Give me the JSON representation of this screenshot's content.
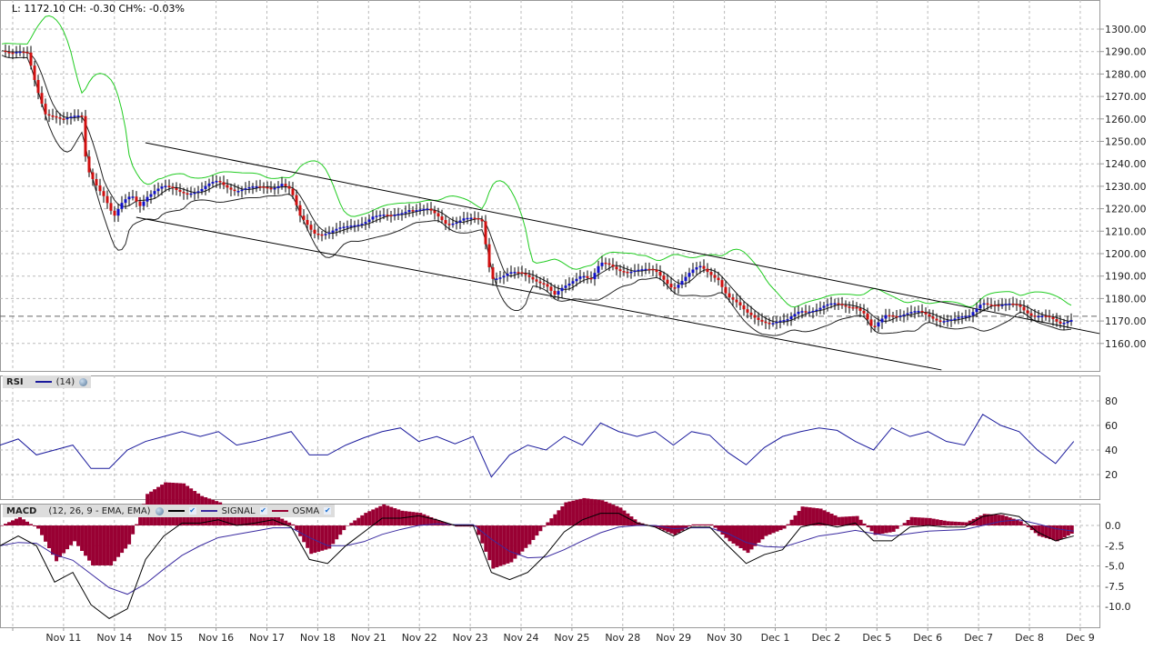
{
  "info": {
    "last": "L: 1172.10",
    "change": "CH: -0.30",
    "change_pct": "CH%: -0.03%"
  },
  "rsi_legend": {
    "name": "RSI",
    "params": "(14)"
  },
  "macd_legend": {
    "name": "MACD",
    "params": "(12, 26, 9 - EMA, EMA)",
    "signal": "SIGNAL",
    "osma": "OSMA"
  },
  "colors": {
    "up": "#1010c8",
    "down": "#d01010",
    "band": "#22cc22",
    "rsi": "#1a1a9c",
    "signal": "#3a2aa0",
    "osma": "#990033"
  },
  "chart_data": [
    {
      "type": "candlestick",
      "title": "Price",
      "current_price": 1172.1,
      "y_ticks": [
        "1300.00",
        "1290.00",
        "1280.00",
        "1270.00",
        "1260.00",
        "1250.00",
        "1240.00",
        "1230.00",
        "1220.00",
        "1210.00",
        "1200.00",
        "1190.00",
        "1180.00",
        "1170.00",
        "1160.00"
      ],
      "ylim": [
        1148,
        1313
      ],
      "x_labels": [
        "Nov 11",
        "Nov 14",
        "Nov 15",
        "Nov 16",
        "Nov 17",
        "Nov 18",
        "Nov 21",
        "Nov 22",
        "Nov 23",
        "Nov 24",
        "Nov 25",
        "Nov 28",
        "Nov 29",
        "Nov 30",
        "Dec 1",
        "Dec 2",
        "Dec 5",
        "Dec 6",
        "Dec 7",
        "Dec 8",
        "Dec 9"
      ],
      "close_points_day_index": [
        [
          -0.25,
          1290.7
        ],
        [
          0.11,
          1290.7
        ],
        [
          0.29,
          1288.7
        ],
        [
          0.47,
          1272.5
        ],
        [
          0.64,
          1262.3
        ],
        [
          0.82,
          1262.3
        ],
        [
          1.0,
          1260.3
        ],
        [
          1.18,
          1260.3
        ],
        [
          1.36,
          1260.3
        ],
        [
          1.45,
          1238.1
        ],
        [
          1.63,
          1232.0
        ],
        [
          1.81,
          1225.9
        ],
        [
          1.99,
          1215.8
        ],
        [
          2.16,
          1221.9
        ],
        [
          2.34,
          1225.9
        ],
        [
          2.52,
          1221.9
        ],
        [
          2.61,
          1225.9
        ],
        [
          2.79,
          1227.9
        ],
        [
          2.97,
          1229.1
        ],
        [
          3.33,
          1227.9
        ],
        [
          3.69,
          1227.9
        ],
        [
          3.86,
          1230.0
        ],
        [
          4.04,
          1232.0
        ],
        [
          4.4,
          1228.7
        ],
        [
          4.76,
          1228.7
        ],
        [
          5.12,
          1230.0
        ],
        [
          5.3,
          1232.0
        ],
        [
          5.47,
          1227.9
        ],
        [
          5.65,
          1215.8
        ],
        [
          5.92,
          1209.7
        ],
        [
          6.19,
          1209.7
        ],
        [
          6.55,
          1210.9
        ],
        [
          6.82,
          1213.8
        ],
        [
          7.08,
          1217.0
        ],
        [
          7.44,
          1215.8
        ],
        [
          7.8,
          1220.6
        ],
        [
          8.16,
          1219.0
        ],
        [
          8.52,
          1213.8
        ],
        [
          8.87,
          1215.8
        ],
        [
          9.23,
          1213.8
        ],
        [
          9.41,
          1189.5
        ],
        [
          9.77,
          1191.5
        ],
        [
          10.13,
          1189.5
        ],
        [
          10.48,
          1187.4
        ],
        [
          10.66,
          1181.4
        ],
        [
          10.93,
          1185.4
        ],
        [
          11.2,
          1191.5
        ],
        [
          11.38,
          1189.5
        ],
        [
          11.56,
          1195.5
        ],
        [
          11.91,
          1192.3
        ],
        [
          12.27,
          1193.5
        ],
        [
          12.63,
          1191.5
        ],
        [
          12.99,
          1185.4
        ],
        [
          13.35,
          1191.5
        ],
        [
          13.52,
          1193.5
        ],
        [
          13.88,
          1189.5
        ],
        [
          14.06,
          1181.4
        ],
        [
          14.42,
          1173.3
        ],
        [
          14.69,
          1171.3
        ],
        [
          14.96,
          1169.2
        ],
        [
          15.22,
          1169.2
        ],
        [
          15.49,
          1175.3
        ],
        [
          15.85,
          1175.3
        ],
        [
          16.21,
          1177.3
        ],
        [
          16.57,
          1177.3
        ],
        [
          16.74,
          1173.3
        ],
        [
          16.92,
          1165.2
        ],
        [
          17.19,
          1173.3
        ],
        [
          17.46,
          1173.3
        ],
        [
          17.82,
          1173.3
        ],
        [
          18.18,
          1171.3
        ],
        [
          18.53,
          1170.4
        ],
        [
          18.8,
          1171.3
        ],
        [
          19.07,
          1179.4
        ],
        [
          19.43,
          1176.1
        ],
        [
          19.79,
          1177.3
        ],
        [
          20.05,
          1173.3
        ],
        [
          20.32,
          1171.3
        ],
        [
          20.59,
          1168.4
        ],
        [
          20.86,
          1172.1
        ]
      ],
      "trendlines": [
        {
          "name": "upper",
          "from": [
            2.61,
            1249.4
          ],
          "to": [
            21.38,
            1164.4
          ]
        },
        {
          "name": "lower",
          "from": [
            2.43,
            1216.2
          ],
          "to": [
            18.27,
            1148.2
          ]
        }
      ]
    },
    {
      "type": "line",
      "title": "RSI (14)",
      "y_ticks": [
        "80",
        "60",
        "40",
        "20"
      ],
      "ylim": [
        0,
        100
      ],
      "sample_step_days": 0.358,
      "start_day_index": -0.25,
      "values": [
        44,
        49,
        36,
        40,
        44,
        25,
        25,
        40,
        47,
        51,
        55,
        51,
        55,
        44,
        47,
        51,
        55,
        36,
        36,
        44,
        50,
        55,
        58,
        47,
        51,
        45,
        51,
        18,
        36,
        44,
        40,
        51,
        44,
        62,
        55,
        51,
        55,
        44,
        55,
        52,
        38,
        28,
        42,
        51,
        55,
        58,
        56,
        47,
        40,
        58,
        51,
        55,
        47,
        44,
        69,
        60,
        55,
        40,
        29,
        47
      ]
    },
    {
      "type": "line",
      "title": "MACD (12, 26, 9 - EMA, EMA)",
      "y_ticks": [
        "0.0",
        "-2.5",
        "-5.0",
        "-7.5",
        "-10.0"
      ],
      "ylim": [
        -12.5,
        2.5
      ],
      "sample_step_days": 0.358,
      "start_day_index": -0.25,
      "series": [
        {
          "name": "MACD",
          "values": [
            -2.5,
            -1.3,
            -2.5,
            -7.0,
            -5.8,
            -9.8,
            -11.5,
            -10.3,
            -4.2,
            -1.3,
            0.3,
            0.3,
            0.7,
            0,
            0.3,
            0.7,
            -0.2,
            -4.2,
            -4.7,
            -2.5,
            -0.8,
            0.9,
            0.9,
            1.2,
            0.7,
            0,
            0,
            -5.8,
            -6.7,
            -5.8,
            -3.6,
            -0.8,
            0.7,
            1.5,
            1.5,
            0.3,
            -0.2,
            -1.3,
            -0.2,
            -0.2,
            -2.5,
            -4.7,
            -3.6,
            -3.0,
            -0.2,
            0.3,
            -0.2,
            0.3,
            -1.9,
            -1.9,
            -0.2,
            0,
            -0.2,
            -0.2,
            1.1,
            1.5,
            1.1,
            -0.8,
            -1.9,
            -1.3
          ]
        },
        {
          "name": "SIGNAL",
          "values": [
            -2.5,
            -2.1,
            -2.2,
            -3.6,
            -4.3,
            -6.0,
            -7.7,
            -8.5,
            -7.2,
            -5.4,
            -3.7,
            -2.5,
            -1.5,
            -1.1,
            -0.7,
            -0.3,
            -0.3,
            -1.5,
            -2.5,
            -2.5,
            -2.0,
            -1.1,
            -0.5,
            0.0,
            0.2,
            0.1,
            0.1,
            -1.7,
            -3.2,
            -4.0,
            -3.9,
            -3.0,
            -1.9,
            -0.9,
            -0.2,
            0.0,
            0.0,
            -0.4,
            -0.3,
            -0.3,
            -1.0,
            -2.1,
            -2.6,
            -2.7,
            -2.0,
            -1.3,
            -1.0,
            -0.6,
            -1.0,
            -1.3,
            -1.0,
            -0.7,
            -0.6,
            -0.5,
            0.0,
            0.5,
            0.7,
            0.2,
            -0.4,
            -0.7
          ]
        },
        {
          "name": "OSMA",
          "derived": "MACD - SIGNAL"
        }
      ]
    }
  ]
}
